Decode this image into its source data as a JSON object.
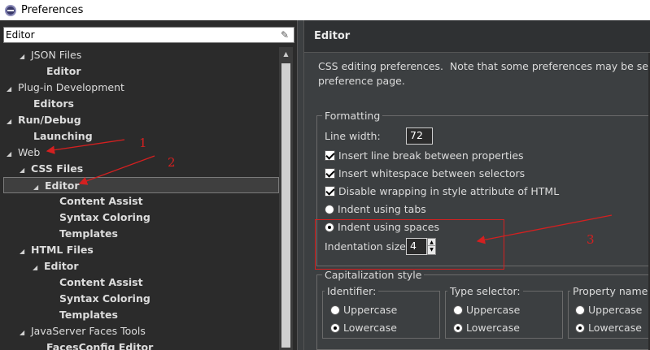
{
  "window": {
    "title": "Preferences",
    "icon": "eclipse-icon"
  },
  "filter": {
    "value": "Editor",
    "clear_icon": "eraser-icon"
  },
  "tree": [
    {
      "label": "JSON Files",
      "level": 2,
      "expander": "expanded",
      "bold": false
    },
    {
      "label": "Editor",
      "level": 3,
      "expander": "none",
      "bold": true
    },
    {
      "label": "Plug-in Development",
      "level": 0,
      "expander": "expanded",
      "bold": false
    },
    {
      "label": "Editors",
      "level": 1,
      "expander": "none",
      "bold": true
    },
    {
      "label": "Run/Debug",
      "level": 0,
      "expander": "expanded",
      "bold": true
    },
    {
      "label": "Launching",
      "level": 1,
      "expander": "none",
      "bold": true
    },
    {
      "label": "Web",
      "level": 0,
      "expander": "expanded",
      "bold": false
    },
    {
      "label": "CSS Files",
      "level": 1,
      "expander": "expanded",
      "bold": true
    },
    {
      "label": "Editor",
      "level": 2,
      "expander": "expanded",
      "bold": true,
      "selected": true
    },
    {
      "label": "Content Assist",
      "level": 3,
      "expander": "none",
      "bold": true
    },
    {
      "label": "Syntax Coloring",
      "level": 3,
      "expander": "none",
      "bold": true
    },
    {
      "label": "Templates",
      "level": 3,
      "expander": "none",
      "bold": true
    },
    {
      "label": "HTML Files",
      "level": 1,
      "expander": "expanded",
      "bold": true
    },
    {
      "label": "Editor",
      "level": 2,
      "expander": "expanded",
      "bold": true
    },
    {
      "label": "Content Assist",
      "level": 3,
      "expander": "none",
      "bold": true
    },
    {
      "label": "Syntax Coloring",
      "level": 3,
      "expander": "none",
      "bold": true
    },
    {
      "label": "Templates",
      "level": 3,
      "expander": "none",
      "bold": true
    },
    {
      "label": "JavaServer Faces Tools",
      "level": 1,
      "expander": "expanded",
      "bold": false
    },
    {
      "label": "FacesConfig Editor",
      "level": 2,
      "expander": "none",
      "bold": true
    }
  ],
  "page": {
    "title": "Editor",
    "description": "CSS editing preferences.  Note that some preferences may be set on t\npreference page.",
    "formatting": {
      "legend": "Formatting",
      "line_width_label": "Line width:",
      "line_width_value": "72",
      "insert_line_break": {
        "label": "Insert line break between properties",
        "checked": true
      },
      "insert_whitespace": {
        "label": "Insert whitespace between selectors",
        "checked": true
      },
      "disable_wrapping": {
        "label": "Disable wrapping in style attribute of HTML",
        "checked": true
      },
      "indent_tabs": {
        "label": "Indent using tabs",
        "checked": false
      },
      "indent_spaces": {
        "label": "Indent using spaces",
        "checked": true
      },
      "indentation_size_label": "Indentation size:",
      "indentation_size_value": "4"
    },
    "capitalization": {
      "legend": "Capitalization style",
      "groups": [
        {
          "legend": "Identifier:",
          "uppercase": "Uppercase",
          "lowercase": "Lowercase",
          "selected": "lowercase"
        },
        {
          "legend": "Type selector:",
          "uppercase": "Uppercase",
          "lowercase": "Lowercase",
          "selected": "lowercase"
        },
        {
          "legend": "Property name:",
          "uppercase": "Uppercase",
          "lowercase": "Lowercase",
          "selected": "lowercase"
        }
      ]
    }
  },
  "annotations": {
    "marker_1": "1",
    "marker_2": "2",
    "marker_3": "3",
    "color": "#d42020"
  },
  "colors": {
    "tree_bg": "#2b2b2b",
    "panel_bg": "#3c3f41",
    "text": "#dcdcdc"
  }
}
